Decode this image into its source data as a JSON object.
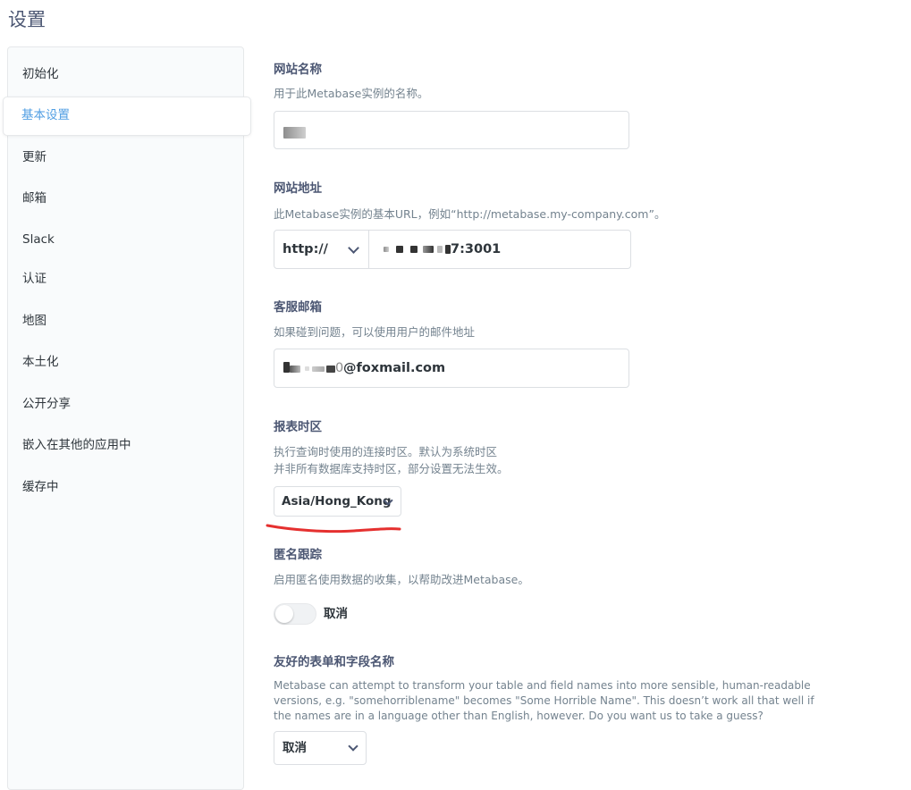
{
  "page": {
    "title": "设置"
  },
  "sidebar": {
    "items": [
      {
        "label": "初始化"
      },
      {
        "label": "基本设置",
        "active": true
      },
      {
        "label": "更新"
      },
      {
        "label": "邮箱"
      },
      {
        "label": "Slack"
      },
      {
        "label": "认证"
      },
      {
        "label": "地图"
      },
      {
        "label": "本土化"
      },
      {
        "label": "公开分享"
      },
      {
        "label": "嵌入在其他的应用中"
      },
      {
        "label": "缓存中"
      }
    ]
  },
  "settings": {
    "site_name": {
      "title": "网站名称",
      "description": "用于此Metabase实例的名称。"
    },
    "site_url": {
      "title": "网站地址",
      "description": "此Metabase实例的基本URL，例如“http://metabase.my-company.com”。",
      "scheme": "http://",
      "value_suffix": "7:3001"
    },
    "admin_email": {
      "title": "客服邮箱",
      "description": "如果碰到问题，可以使用用户的邮件地址",
      "value_suffix": "@foxmail.com",
      "value_partial": "0"
    },
    "report_timezone": {
      "title": "报表时区",
      "description_line1": "执行查询时使用的连接时区。默认为系统时区",
      "description_line2": "并非所有数据库支持时区，部分设置无法生效。",
      "value": "Asia/Hong_Kong"
    },
    "anonymous_tracking": {
      "title": "匿名跟踪",
      "description": "启用匿名使用数据的收集，以帮助改进Metabase。",
      "toggle_label": "取消",
      "enabled": false
    },
    "friendly_names": {
      "title": "友好的表单和字段名称",
      "description_line1": "Metabase can attempt to transform your table and field names into more sensible, human-readable",
      "description_line2": "versions, e.g. \"somehorriblename\" becomes \"Some Horrible Name\". This doesn’t work all that well if",
      "description_line3": "the names are in a language other than English, however. Do you want us to take a guess?",
      "value": "取消"
    }
  },
  "colors": {
    "brand": "#509ee3",
    "annotation": "#e5302f"
  },
  "icons": {
    "dropdown": "chevron-down-icon"
  }
}
